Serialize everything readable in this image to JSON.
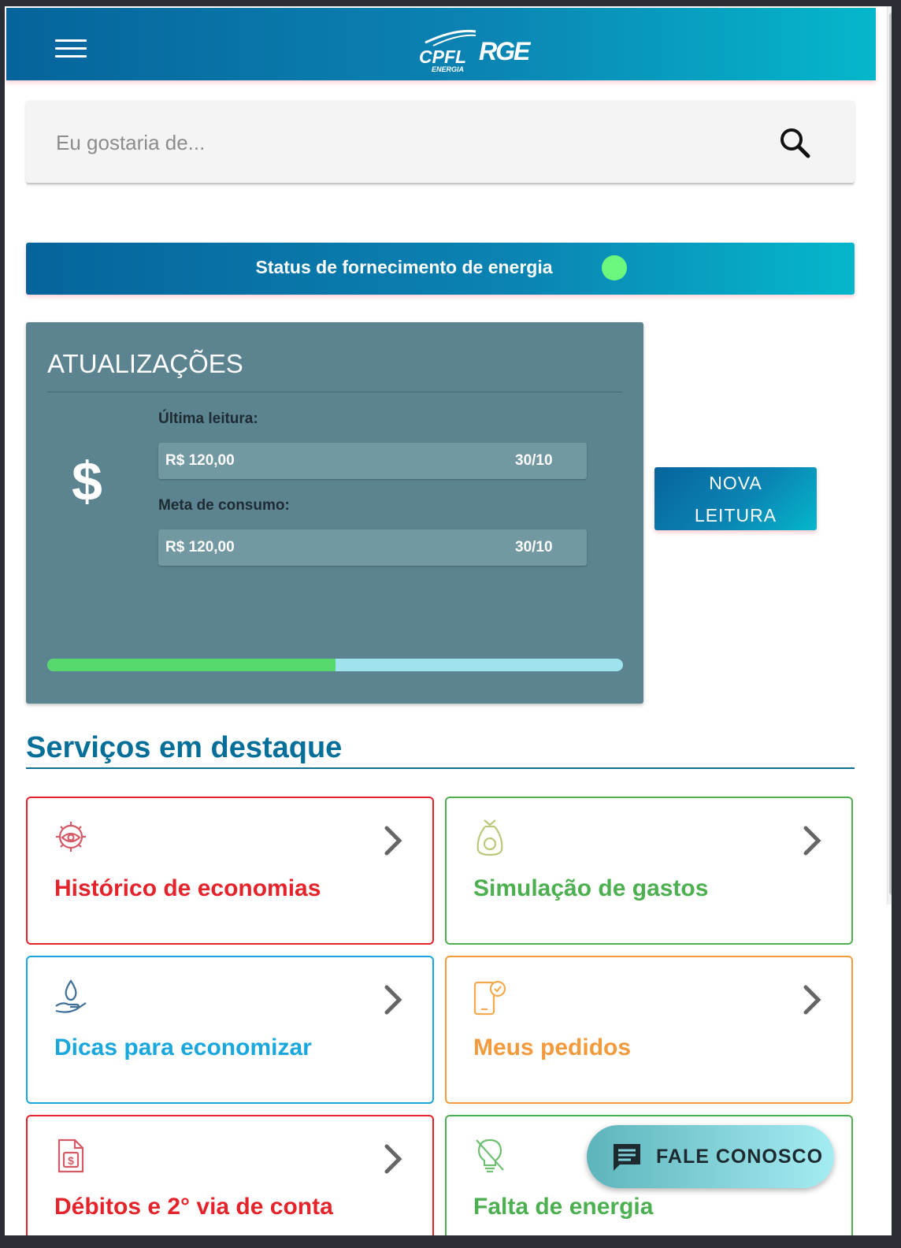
{
  "header": {
    "logo": {
      "brand_primary": "CPFL",
      "brand_sub": "ENERGIA",
      "brand_secondary": "RGE"
    },
    "menu_icon": "hamburger-menu-icon"
  },
  "search": {
    "placeholder": "Eu gostaria de...",
    "value": "",
    "icon": "search-icon"
  },
  "status": {
    "label": "Status de fornecimento de energia",
    "indicator_color": "#6cf87f"
  },
  "updates": {
    "title": "ATUALIZAÇÕES",
    "icon": "$",
    "last_reading": {
      "label": "Última leitura:",
      "amount": "R$ 120,00",
      "date": "30/10"
    },
    "consumption_goal": {
      "label": "Meta de consumo:",
      "amount": "R$ 120,00",
      "date": "30/10"
    },
    "progress": 0.5
  },
  "new_reading_button": {
    "line1": "NOVA",
    "line2": "LEITURA"
  },
  "featured": {
    "title": "Serviços em destaque",
    "items": [
      {
        "label": "Histórico de economias",
        "icon": "eye-gear-icon",
        "color": "#e4232b"
      },
      {
        "label": "Simulação de gastos",
        "icon": "money-bag-icon",
        "color": "#4caf50"
      },
      {
        "label": "Dicas para economizar",
        "icon": "hand-drop-icon",
        "color": "#1aa7dd"
      },
      {
        "label": "Meus pedidos",
        "icon": "phone-check-icon",
        "color": "#f39a3d"
      },
      {
        "label": "Débitos e 2° via de conta",
        "icon": "invoice-dollar-icon",
        "color": "#e4232b"
      },
      {
        "label": "Falta de energia",
        "icon": "bulb-off-icon",
        "color": "#4caf50"
      }
    ]
  },
  "fab": {
    "label": "FALE CONOSCO",
    "icon": "chat-icon"
  },
  "colors": {
    "brand_dark": "#06649b",
    "brand_light": "#05b7cb",
    "card_bg": "#5c8490"
  }
}
